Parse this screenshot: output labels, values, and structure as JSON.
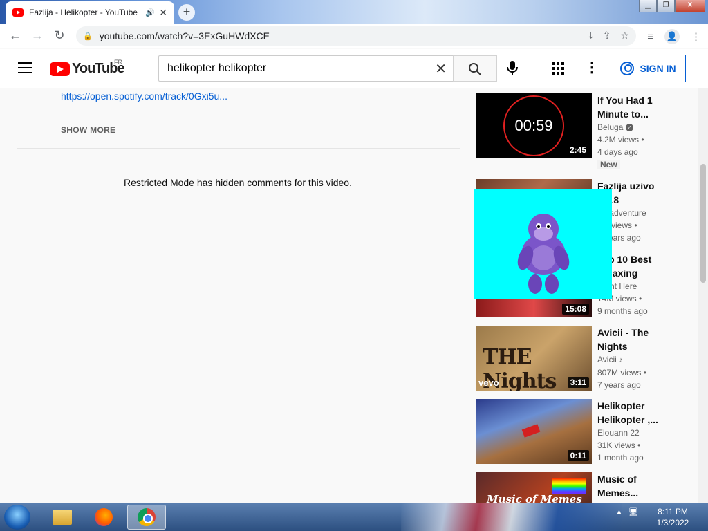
{
  "browser": {
    "tab_title": "Fazlija - Helikopter - YouTube",
    "url": "youtube.com/watch?v=3ExGuHWdXCE"
  },
  "youtube": {
    "logo_text": "YouTube",
    "country_code": "FR",
    "search_value": "helikopter helikopter",
    "sign_in_label": "SIGN IN"
  },
  "description": {
    "link_text": "https://open.spotify.com/track/0Gxi5u...",
    "show_more_label": "SHOW MORE"
  },
  "comments": {
    "restricted_message": "Restricted Mode has hidden comments for this video."
  },
  "recommendations": [
    {
      "title": "If You Had 1 Minute to...",
      "channel": "Beluga",
      "views": "4.2M views •",
      "age": "4 days ago",
      "badge": "New",
      "duration": "2:45",
      "thumb_text": "00:59"
    },
    {
      "title": "Fazlija uzivo 2018",
      "channel": "Mr adventure",
      "views": "1M views •",
      "age": "3 years ago",
      "duration": ""
    },
    {
      "title": "Top 10 Best Relaxing Songs...",
      "channel": "Right Here",
      "views": "14M views •",
      "age": "9 months ago",
      "duration": "15:08"
    },
    {
      "title": "Avicii - The Nights",
      "channel": "Avicii",
      "views": "807M views •",
      "age": "7 years ago",
      "duration": "3:11",
      "thumb_text": "THE Nights",
      "thumb_badge": "vevo"
    },
    {
      "title": "Helikopter Helikopter ,...",
      "channel": "Elouann 22",
      "views": "31K views •",
      "age": "1 month ago",
      "duration": "0:11"
    },
    {
      "title": "Music of Memes...",
      "channel": "",
      "views": "",
      "age": "",
      "duration": "",
      "thumb_text": "Music of Memes"
    }
  ],
  "taskbar": {
    "time": "8:11 PM",
    "date": "1/3/2022"
  },
  "colors": {
    "accent_blue": "#065fd4",
    "youtube_red": "#ff0000",
    "overlay_cyan": "#00ffff",
    "bonzi_purple": "#7b55c9"
  }
}
